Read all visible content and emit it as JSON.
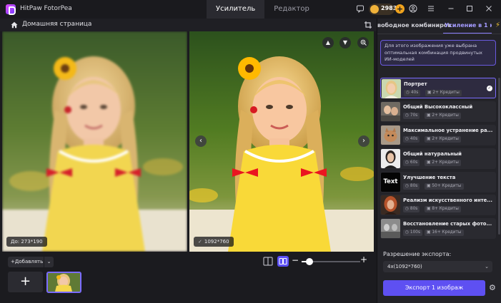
{
  "app": {
    "title": "HitPaw FotorPea",
    "tabs": [
      {
        "label": "Усилитель",
        "active": true
      },
      {
        "label": "Редактор",
        "active": false
      }
    ],
    "credits": "2983",
    "accent_color": "#5e50f2"
  },
  "breadcrumb": {
    "home_label": "Домашняя страница"
  },
  "viewer": {
    "original_size": "До: 273*190",
    "enhanced_size": "1092*760"
  },
  "bottom": {
    "add_label": "Добавлять",
    "add_plus": "+",
    "zoom_level_fraction": 0.14
  },
  "panel": {
    "tabs": [
      {
        "label": "вободное комбиниров"
      },
      {
        "label": "Усиление в 1 кли",
        "active": true
      }
    ],
    "info": "Для этого изображения уже выбрана оптимальная комбинация продвинутых ИИ-моделей",
    "models": [
      {
        "name": "Портрет",
        "time": "40s",
        "credits": "2+ Кредиты",
        "selected": true
      },
      {
        "name": "Общий Высококлассный",
        "time": "70s",
        "credits": "2+ Кредиты"
      },
      {
        "name": "Максимальное устранение ра...",
        "time": "40s",
        "credits": "2+ Кредиты"
      },
      {
        "name": "Общий натуральный",
        "time": "60s",
        "credits": "2+ Кредиты"
      },
      {
        "name": "Улучшение текста",
        "time": "80s",
        "credits": "50+ Кредиты",
        "thumb_text": "Text"
      },
      {
        "name": "Реализм искусственного инте...",
        "time": "80s",
        "credits": "8+ Кредиты"
      },
      {
        "name": "Восстановление старых фото...",
        "time": "100s",
        "credits": "16+ Кредиты"
      }
    ],
    "export_label": "Разрешение экспорта:",
    "export_value": "4x(1092*760)",
    "export_button": "Экспорт 1 изображ"
  }
}
